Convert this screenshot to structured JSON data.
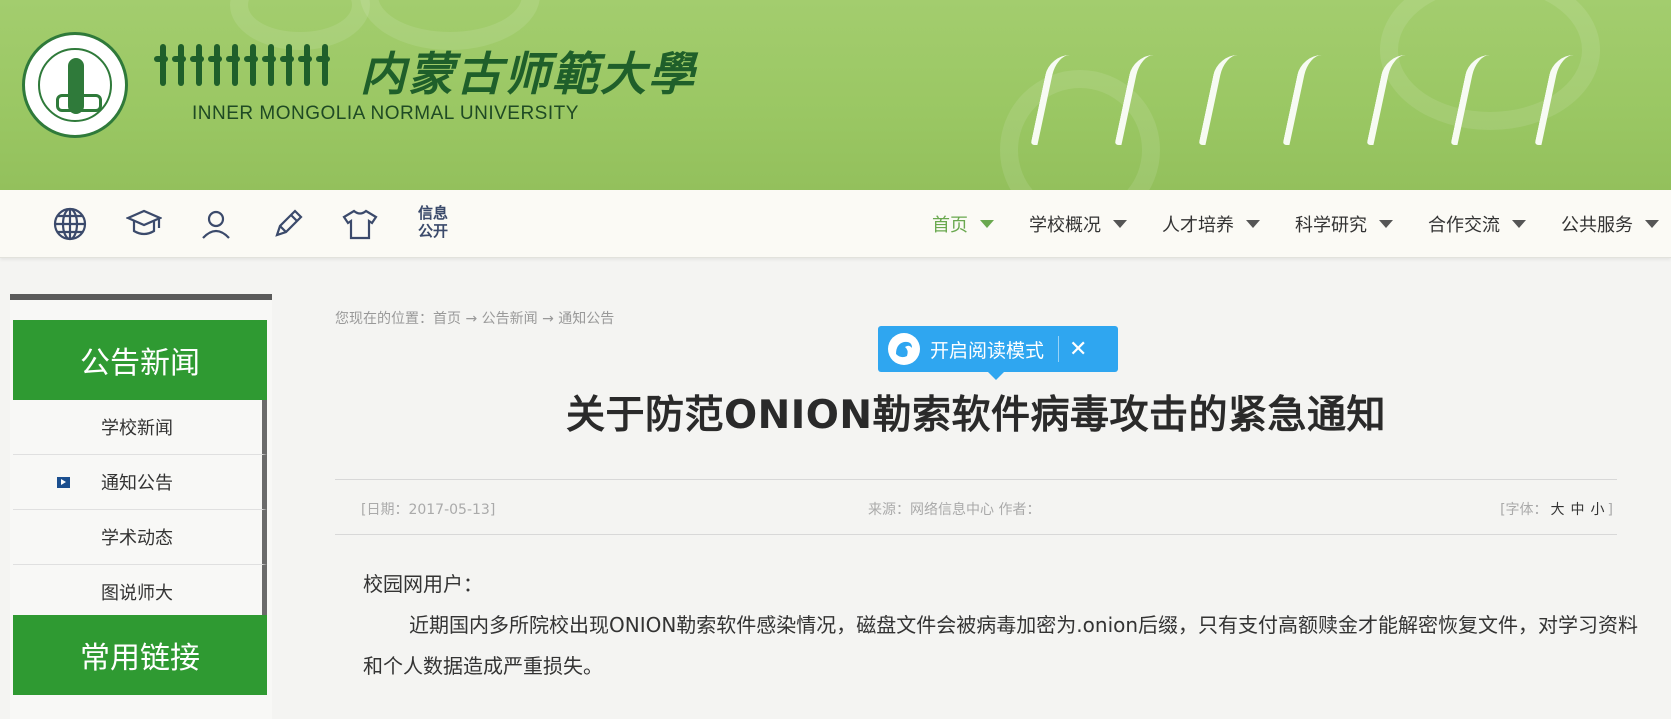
{
  "header": {
    "university_cn": "内蒙古师範大學",
    "university_en": "INNER MONGOLIA NORMAL UNIVERSITY"
  },
  "nav": {
    "icons": [
      "globe-icon",
      "graduation-cap-icon",
      "user-icon",
      "pencil-icon",
      "shirt-icon"
    ],
    "info_open": "信息\n公开",
    "info_open_line1": "信息",
    "info_open_line2": "公开",
    "menu": [
      {
        "label": "首页",
        "active": true
      },
      {
        "label": "学校概况",
        "active": false
      },
      {
        "label": "人才培养",
        "active": false
      },
      {
        "label": "科学研究",
        "active": false
      },
      {
        "label": "合作交流",
        "active": false
      },
      {
        "label": "公共服务",
        "active": false
      }
    ]
  },
  "sidebar": {
    "section_title": "公告新闻",
    "items": [
      {
        "label": "学校新闻",
        "selected": false
      },
      {
        "label": "通知公告",
        "selected": true
      },
      {
        "label": "学术动态",
        "selected": false
      },
      {
        "label": "图说师大",
        "selected": false
      }
    ],
    "links_title": "常用链接"
  },
  "main": {
    "breadcrumb": "您现在的位置：首页 → 公告新闻 → 通知公告",
    "reader_mode": "开启阅读模式",
    "reader_close": "✕",
    "title": "关于防范ONION勒索软件病毒攻击的紧急通知",
    "date": "[日期：2017-05-13]",
    "source": "来源：网络信息中心  作者：",
    "font_size_label": "[字体：",
    "font_large": "大",
    "font_medium": "中",
    "font_small": "小",
    "font_end": "]",
    "greeting": "校园网用户：",
    "paragraph1": "近期国内多所院校出现ONION勒索软件感染情况，磁盘文件会被病毒加密为.onion后缀，只有支付高额赎金才能解密恢复文件，对学习资料和个人数据造成严重损失。"
  },
  "colors": {
    "banner_green": "#9ac763",
    "sidebar_green": "#2f9a32",
    "active_menu": "#6aa84f",
    "reader_blue": "#2fa6f0"
  }
}
